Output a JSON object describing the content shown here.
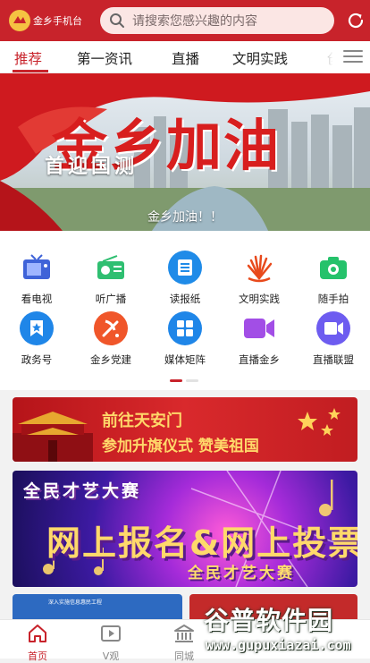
{
  "header": {
    "app_name": "金乡手机台",
    "search_placeholder": "请搜索您感兴趣的内容",
    "colors": {
      "brand": "#c8232b"
    }
  },
  "tabs": [
    {
      "label": "推荐",
      "active": true
    },
    {
      "label": "第一资讯",
      "active": false
    },
    {
      "label": "直播",
      "active": false
    },
    {
      "label": "文明实践",
      "active": false
    },
    {
      "label": "创",
      "active": false
    }
  ],
  "banner": {
    "slogan": "金乡加油",
    "title": "首迎国测",
    "caption": "金乡加油！！"
  },
  "services": [
    {
      "label": "看电视",
      "icon": "tv-icon"
    },
    {
      "label": "听广播",
      "icon": "radio-icon"
    },
    {
      "label": "读报纸",
      "icon": "newspaper-icon"
    },
    {
      "label": "文明实践",
      "icon": "civilization-icon"
    },
    {
      "label": "随手拍",
      "icon": "camera-icon"
    },
    {
      "label": "政务号",
      "icon": "government-account-icon"
    },
    {
      "label": "金乡党建",
      "icon": "party-building-icon"
    },
    {
      "label": "媒体矩阵",
      "icon": "media-matrix-icon"
    },
    {
      "label": "直播金乡",
      "icon": "live-video-icon"
    },
    {
      "label": "直播联盟",
      "icon": "live-alliance-icon"
    }
  ],
  "pager": {
    "page": 1,
    "total": 2
  },
  "promo_flag": {
    "line1": "前往天安门",
    "line2": "参加升旗仪式 赞美祖国"
  },
  "promo_talent": {
    "top": "全民才艺大赛",
    "main": "网上报名&网上投票",
    "bottom": "全民才艺大赛"
  },
  "promo_partial": {
    "text": "深入实施信息惠民工程"
  },
  "bottom_nav": [
    {
      "label": "首页",
      "icon": "home-icon",
      "active": true
    },
    {
      "label": "V观",
      "icon": "video-icon",
      "active": false
    },
    {
      "label": "同城",
      "icon": "city-icon",
      "active": false
    }
  ],
  "watermark": {
    "name": "谷普软件园",
    "url": "www.gupuxiazai.com"
  }
}
